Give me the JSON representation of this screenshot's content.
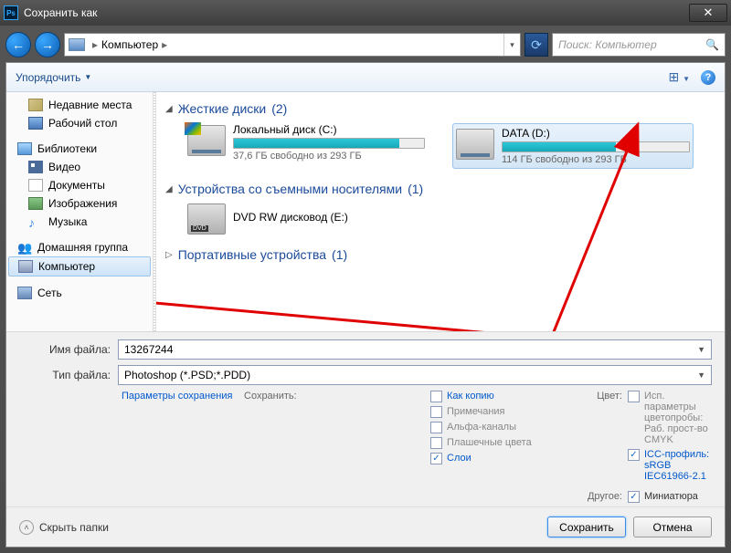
{
  "window": {
    "title": "Сохранить как"
  },
  "nav": {
    "breadcrumb": "Компьютер",
    "search_placeholder": "Поиск: Компьютер"
  },
  "toolbar": {
    "organize": "Упорядочить"
  },
  "sidebar": {
    "recent": "Недавние места",
    "desktop": "Рабочий стол",
    "libraries": "Библиотеки",
    "video": "Видео",
    "documents": "Документы",
    "images": "Изображения",
    "music": "Музыка",
    "homegroup": "Домашняя группа",
    "computer": "Компьютер",
    "network": "Сеть"
  },
  "sections": {
    "hdd": {
      "title": "Жесткие диски",
      "count": "(2)"
    },
    "removable": {
      "title": "Устройства со съемными носителями",
      "count": "(1)"
    },
    "portable": {
      "title": "Портативные устройства",
      "count": "(1)"
    }
  },
  "drives": {
    "c": {
      "name": "Локальный диск (C:)",
      "free": "37,6 ГБ свободно из 293 ГБ",
      "fill_pct": 87
    },
    "d": {
      "name": "DATA (D:)",
      "free": "114 ГБ свободно из 293 ГБ",
      "fill_pct": 61
    },
    "dvd": {
      "name": "DVD RW дисковод (E:)"
    }
  },
  "form": {
    "filename_label": "Имя файла:",
    "filename_value": "13267244",
    "filetype_label": "Тип файла:",
    "filetype_value": "Photoshop (*.PSD;*.PDD)",
    "save_params": "Параметры сохранения"
  },
  "options": {
    "save_head": "Сохранить:",
    "as_copy": "Как копию",
    "notes": "Примечания",
    "alpha": "Альфа-каналы",
    "spot": "Плашечные цвета",
    "layers": "Слои",
    "color_head": "Цвет:",
    "use_proof": "Исп. параметры цветопробы: Раб. прост-во CMYK",
    "icc": "ICC-профиль: sRGB IEC61966-2.1",
    "other_head": "Другое:",
    "thumb": "Миниатюра"
  },
  "footer": {
    "hide": "Скрыть папки",
    "save": "Сохранить",
    "cancel": "Отмена"
  }
}
